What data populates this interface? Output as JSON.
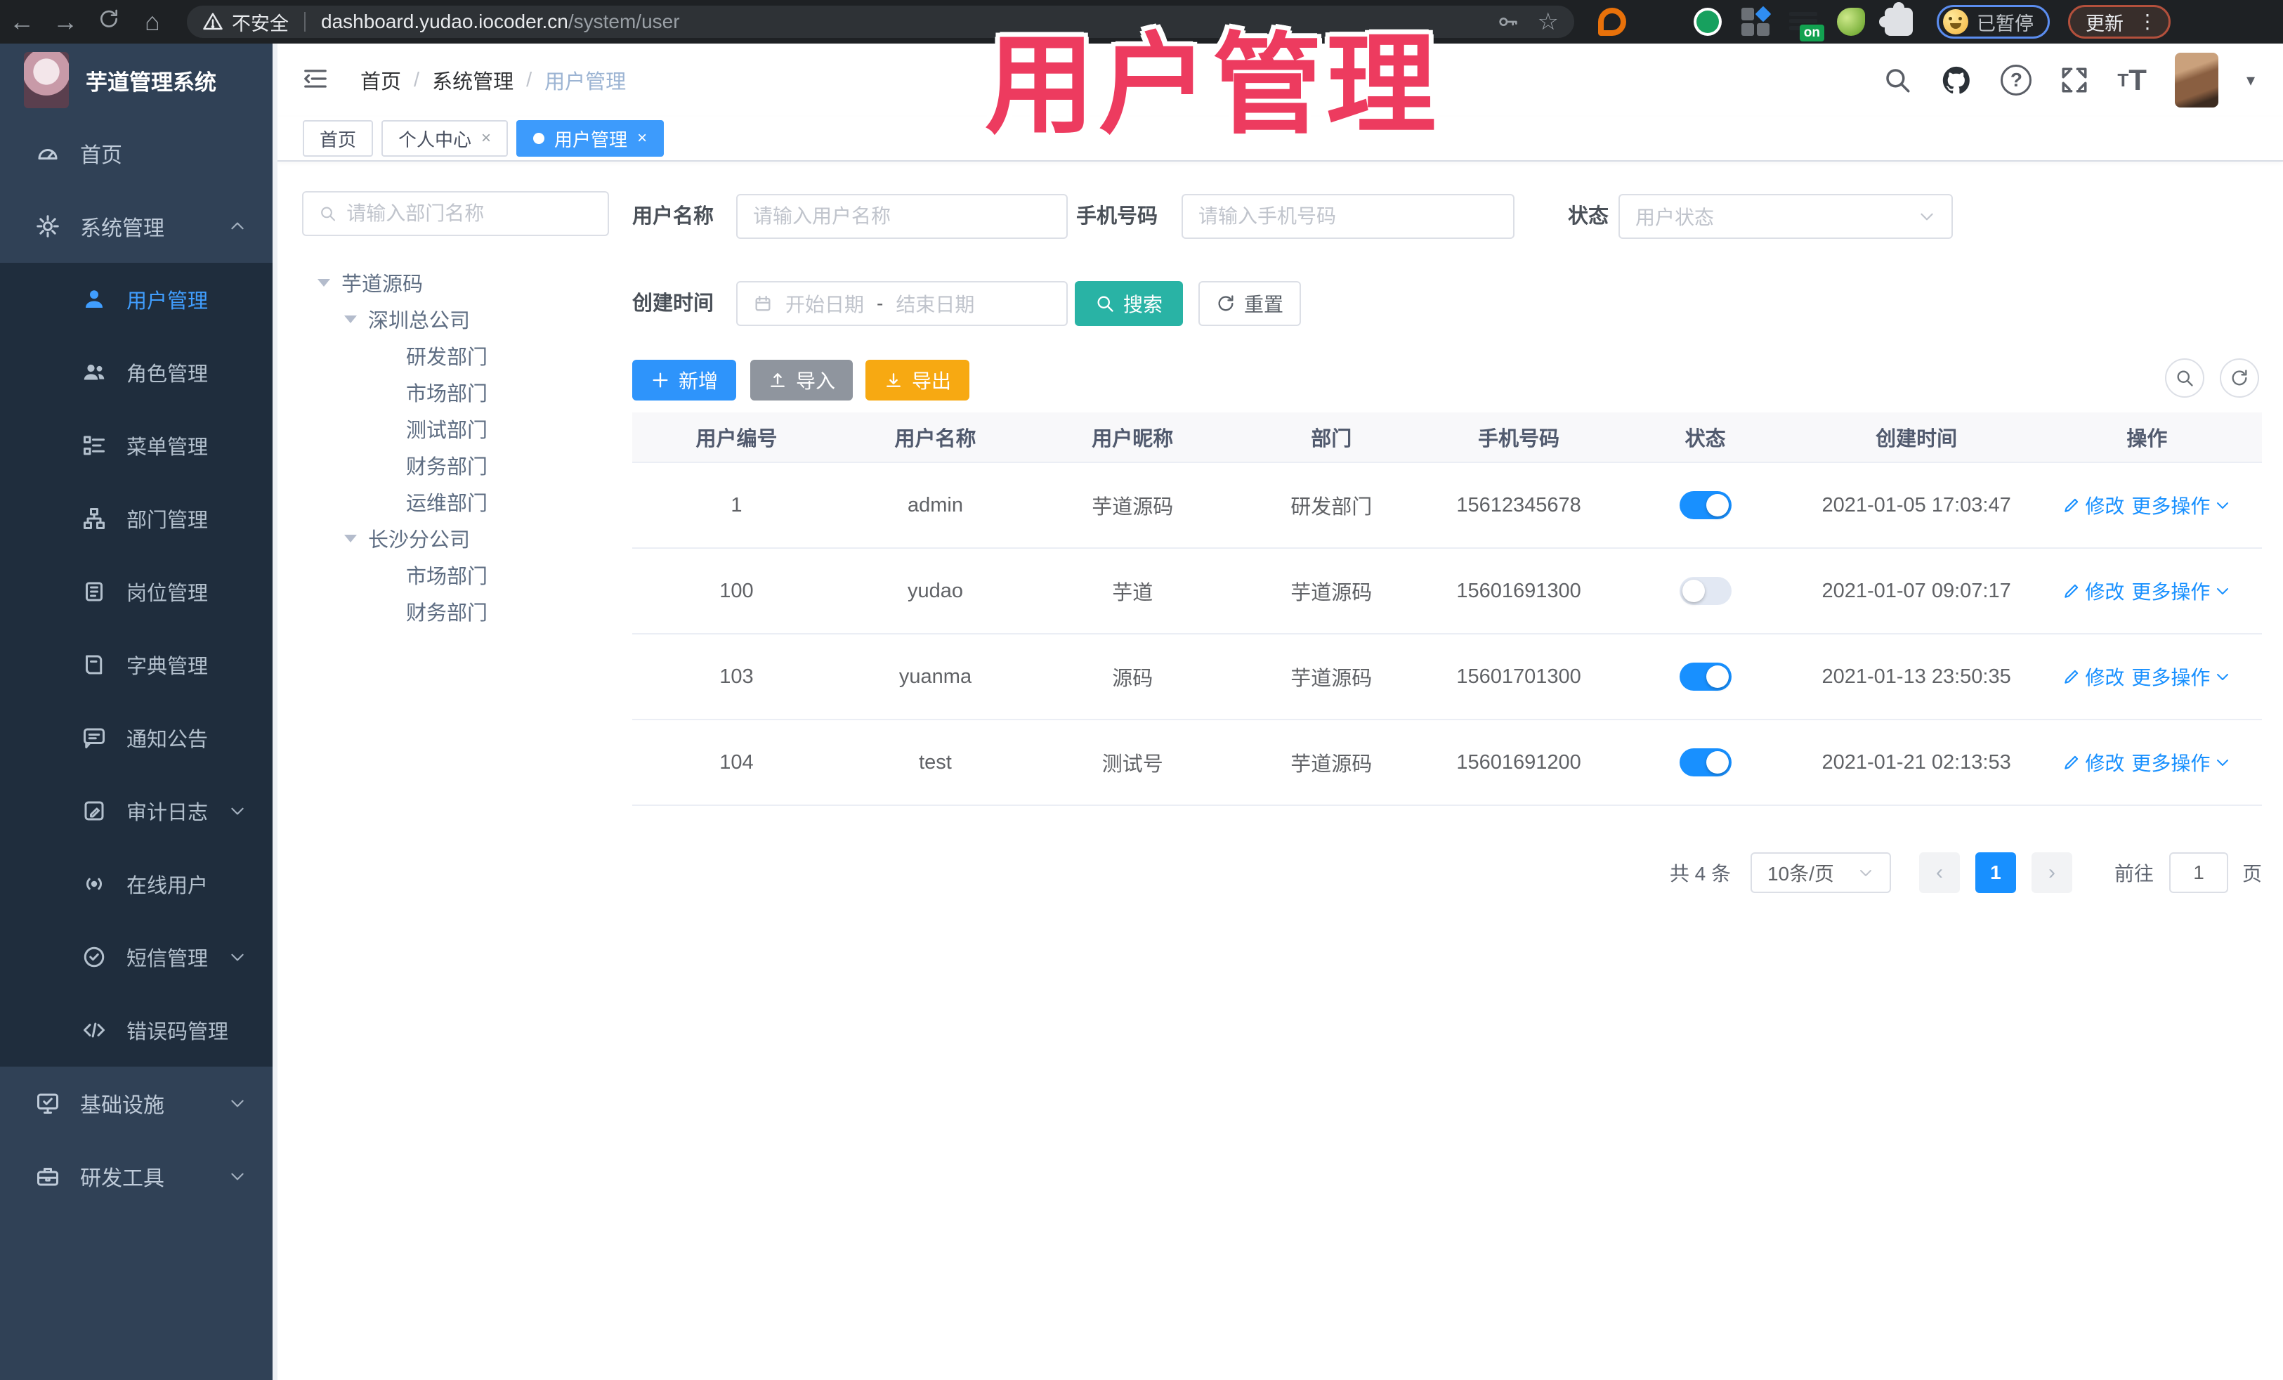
{
  "browser": {
    "security_label": "不安全",
    "url_host": "dashboard.yudao.iocoder.cn",
    "url_path": "/system/user",
    "ext_on_badge": "on",
    "paused_badge": "已暂停",
    "update_label": "更新"
  },
  "overlay": {
    "title": "用户管理",
    "color": "#ed3b5f"
  },
  "sidebar": {
    "logo_title": "芋道管理系统",
    "items": [
      {
        "label": "首页"
      },
      {
        "label": "系统管理"
      },
      {
        "label": "用户管理"
      },
      {
        "label": "角色管理"
      },
      {
        "label": "菜单管理"
      },
      {
        "label": "部门管理"
      },
      {
        "label": "岗位管理"
      },
      {
        "label": "字典管理"
      },
      {
        "label": "通知公告"
      },
      {
        "label": "审计日志"
      },
      {
        "label": "在线用户"
      },
      {
        "label": "短信管理"
      },
      {
        "label": "错误码管理"
      },
      {
        "label": "基础设施"
      },
      {
        "label": "研发工具"
      }
    ]
  },
  "header": {
    "breadcrumb": [
      "首页",
      "系统管理",
      "用户管理"
    ],
    "separator": "/",
    "help_icon_text": "?",
    "font_icon_small": "T",
    "font_icon_large": "T"
  },
  "tabs": [
    {
      "label": "首页"
    },
    {
      "label": "个人中心"
    },
    {
      "label": "用户管理"
    }
  ],
  "tab_close_glyph": "×",
  "tree": {
    "search_placeholder": "请输入部门名称",
    "nodes": [
      "芋道源码",
      "深圳总公司",
      "研发部门",
      "市场部门",
      "测试部门",
      "财务部门",
      "运维部门",
      "长沙分公司",
      "市场部门",
      "财务部门"
    ]
  },
  "filters": {
    "username_label": "用户名称",
    "username_placeholder": "请输入用户名称",
    "mobile_label": "手机号码",
    "mobile_placeholder": "请输入手机号码",
    "status_label": "状态",
    "status_placeholder": "用户状态",
    "create_time_label": "创建时间",
    "date_start_placeholder": "开始日期",
    "date_separator": "-",
    "date_end_placeholder": "结束日期",
    "search_label": "搜索",
    "reset_label": "重置"
  },
  "toolbar": {
    "add_label": "新增",
    "import_label": "导入",
    "export_label": "导出"
  },
  "table": {
    "columns": [
      "用户编号",
      "用户名称",
      "用户昵称",
      "部门",
      "手机号码",
      "状态",
      "创建时间",
      "操作"
    ],
    "edit_label": "修改",
    "more_label": "更多操作",
    "rows": [
      {
        "id": "1",
        "username": "admin",
        "nickname": "芋道源码",
        "dept": "研发部门",
        "mobile": "15612345678",
        "status": "on",
        "create_time": "2021-01-05 17:03:47"
      },
      {
        "id": "100",
        "username": "yudao",
        "nickname": "芋道",
        "dept": "芋道源码",
        "mobile": "15601691300",
        "status": "off",
        "create_time": "2021-01-07 09:07:17"
      },
      {
        "id": "103",
        "username": "yuanma",
        "nickname": "源码",
        "dept": "芋道源码",
        "mobile": "15601701300",
        "status": "on",
        "create_time": "2021-01-13 23:50:35"
      },
      {
        "id": "104",
        "username": "test",
        "nickname": "测试号",
        "dept": "芋道源码",
        "mobile": "15601691200",
        "status": "on",
        "create_time": "2021-01-21 02:13:53"
      }
    ]
  },
  "pagination": {
    "total_label": "共 4 条",
    "page_size_label": "10条/页",
    "prev_glyph": "‹",
    "next_glyph": "›",
    "current_page": "1",
    "goto_label": "前往",
    "goto_value": "1",
    "page_unit_label": "页"
  },
  "colors": {
    "primary_blue": "#1890ff",
    "sidebar_bg": "#304156",
    "submenu_bg": "#1f2d3d",
    "sidebar_active": "#409eff",
    "search_button_teal": "#29b3a5",
    "export_button_amber": "#f7a912",
    "import_button_gray": "#8f959e",
    "overlay_pink": "#ed3b5f"
  }
}
